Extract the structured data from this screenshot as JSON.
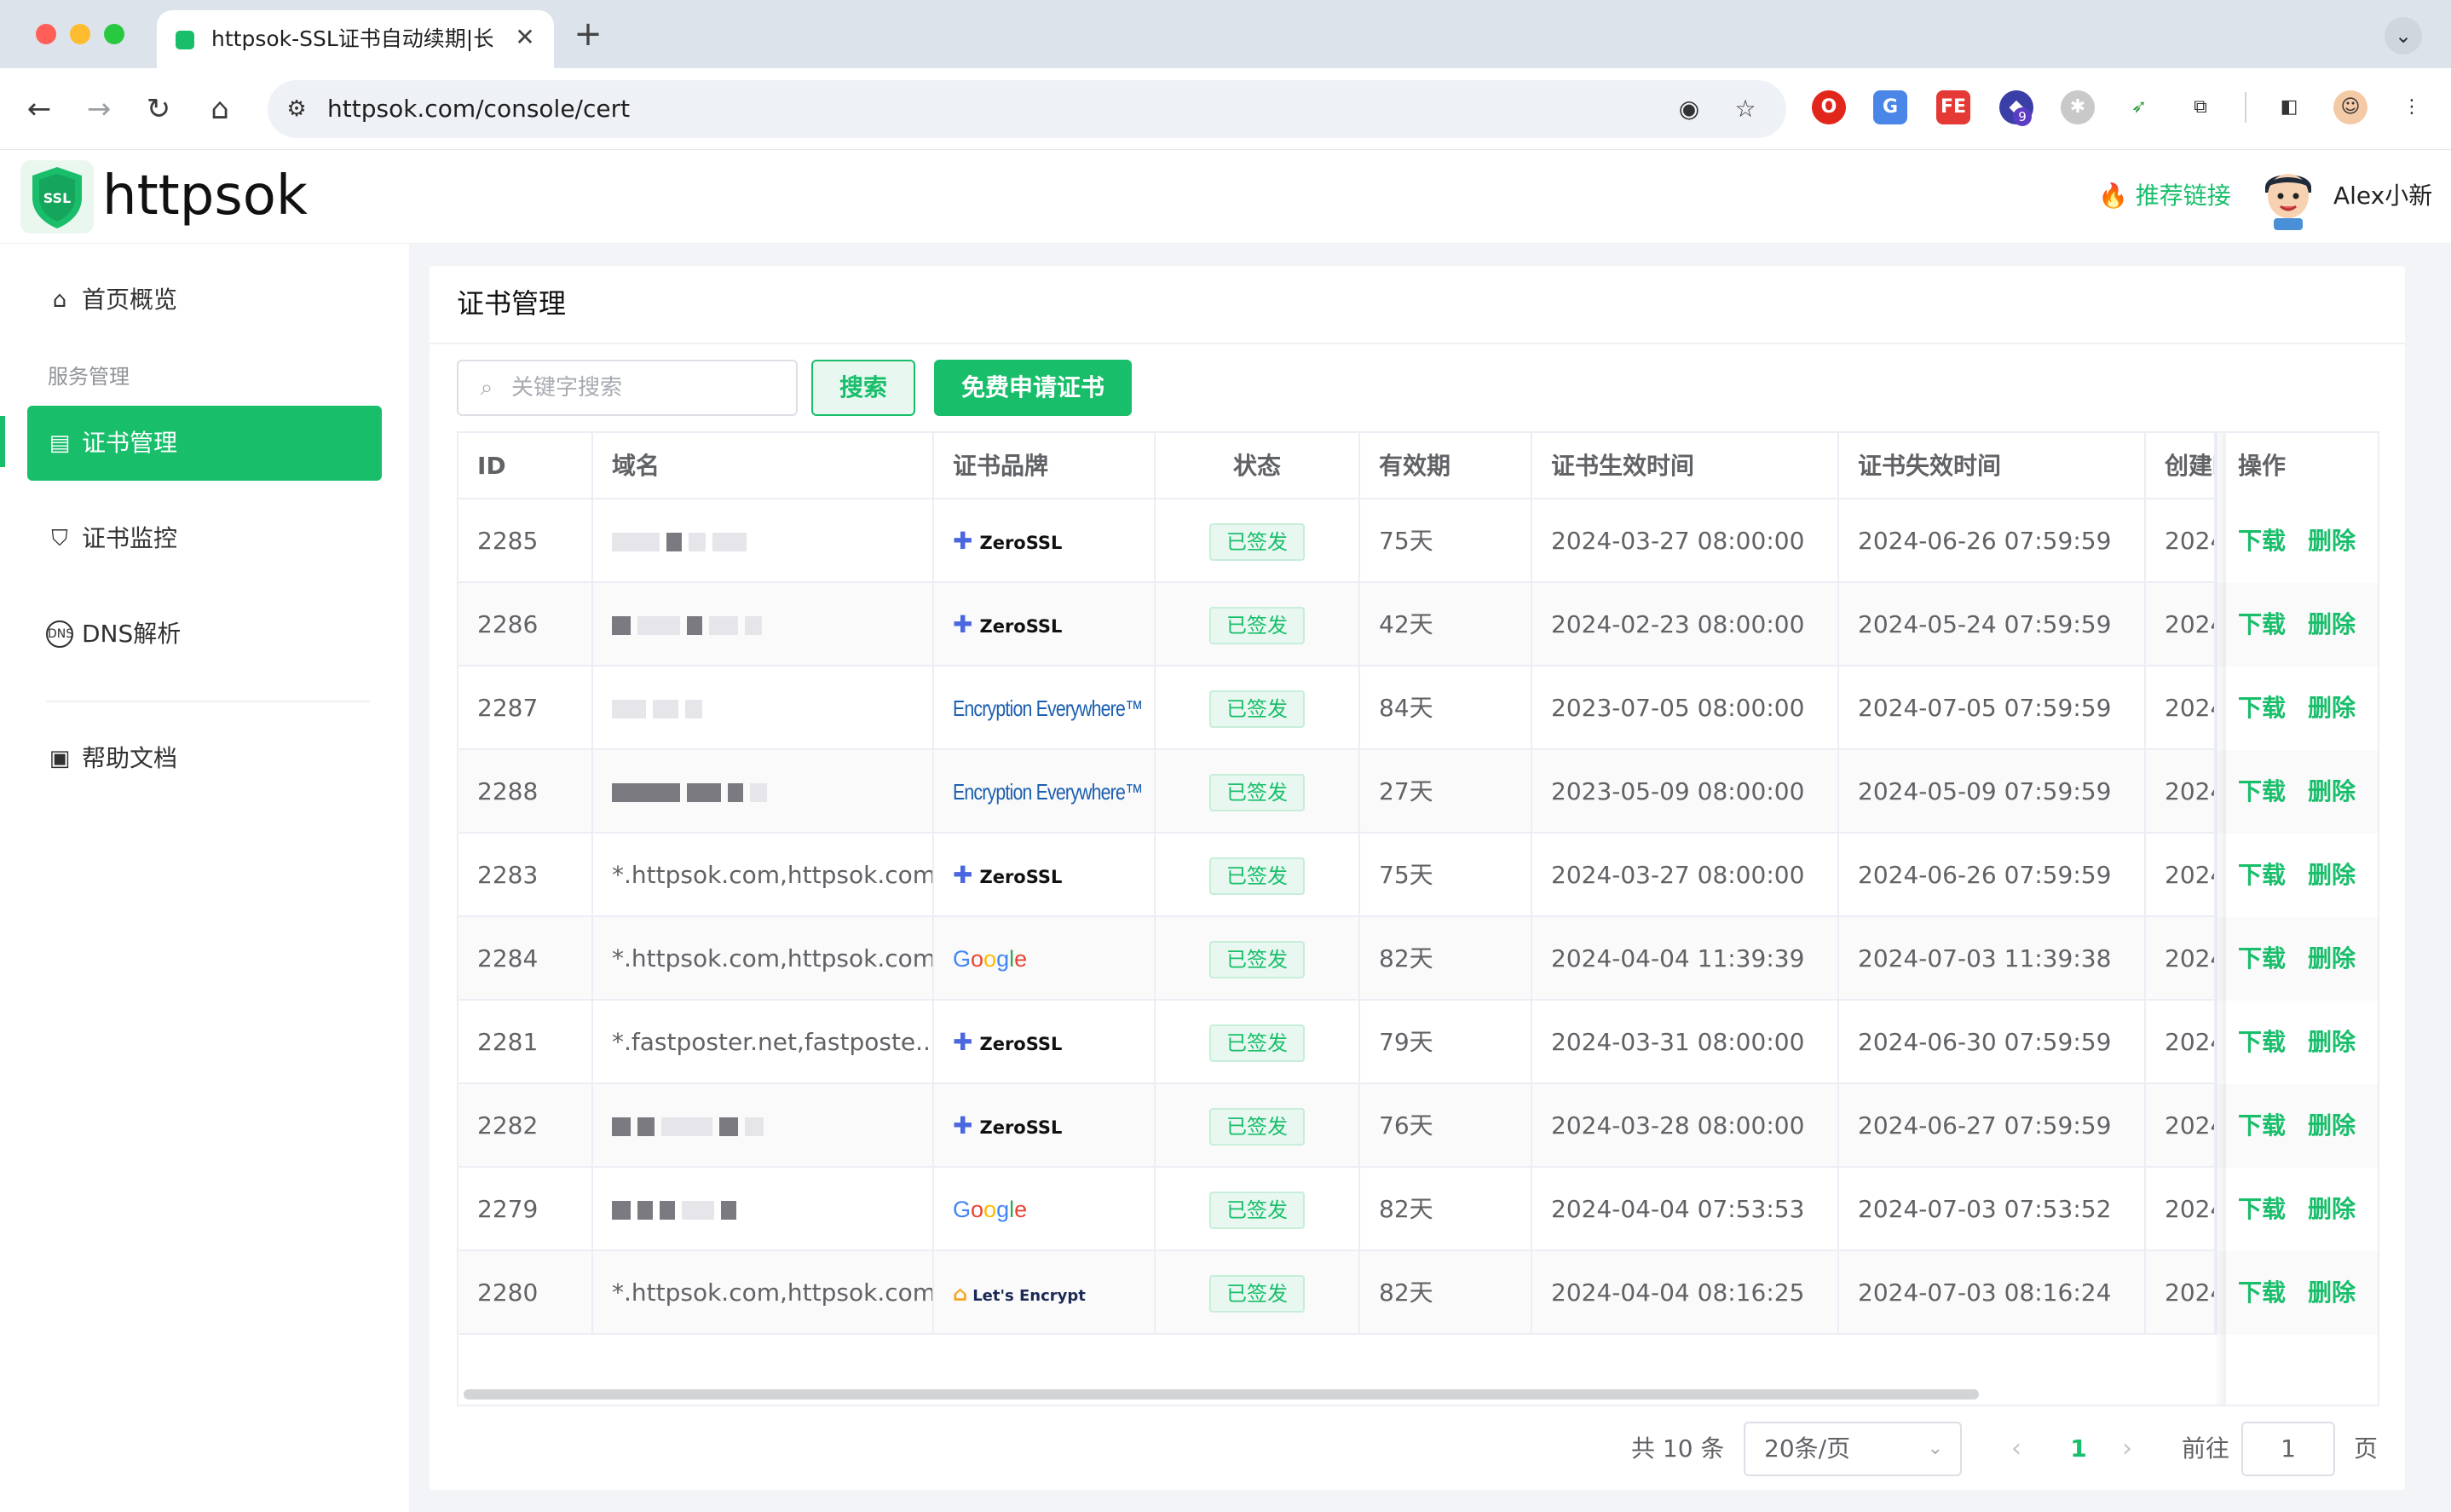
{
  "browser": {
    "tab_title": "httpsok-SSL证书自动续期|长沙",
    "tab_close": "✕",
    "new_tab": "+",
    "url": "httpsok.com/console/cert",
    "extension_badge": "9"
  },
  "header": {
    "logo_text": "httpsok",
    "logo_badge": "SSL",
    "recommend": "推荐链接",
    "recommend_icon": "🔥",
    "username": "Alex小新"
  },
  "sidebar": {
    "items": [
      {
        "label": "首页概览",
        "icon": "home-icon"
      },
      {
        "label": "证书管理",
        "icon": "certificate-icon"
      },
      {
        "label": "证书监控",
        "icon": "shield-icon"
      },
      {
        "label": "DNS解析",
        "icon": "dns-icon"
      },
      {
        "label": "帮助文档",
        "icon": "book-icon"
      }
    ],
    "group_label": "服务管理"
  },
  "page": {
    "title": "证书管理",
    "search_placeholder": "关键字搜索",
    "search_button": "搜索",
    "apply_button": "免费申请证书"
  },
  "table": {
    "columns": [
      "ID",
      "域名",
      "证书品牌",
      "状态",
      "有效期",
      "证书生效时间",
      "证书失效时间",
      "创建时间",
      "操作"
    ],
    "rows": [
      {
        "id": "2285",
        "domain": "",
        "brand": "ZeroSSL",
        "status": "已签发",
        "validity": "75天",
        "start": "2024-03-27 08:00:00",
        "end": "2024-06-26 07:59:59",
        "created": "2024"
      },
      {
        "id": "2286",
        "domain": "",
        "brand": "ZeroSSL",
        "status": "已签发",
        "validity": "42天",
        "start": "2024-02-23 08:00:00",
        "end": "2024-05-24 07:59:59",
        "created": "2024"
      },
      {
        "id": "2287",
        "domain": "",
        "brand": "Encryption Everywhere™",
        "status": "已签发",
        "validity": "84天",
        "start": "2023-07-05 08:00:00",
        "end": "2024-07-05 07:59:59",
        "created": "2024"
      },
      {
        "id": "2288",
        "domain": "",
        "brand": "Encryption Everywhere™",
        "status": "已签发",
        "validity": "27天",
        "start": "2023-05-09 08:00:00",
        "end": "2024-05-09 07:59:59",
        "created": "2024"
      },
      {
        "id": "2283",
        "domain": "*.httpsok.com,httpsok.com",
        "brand": "ZeroSSL",
        "status": "已签发",
        "validity": "75天",
        "start": "2024-03-27 08:00:00",
        "end": "2024-06-26 07:59:59",
        "created": "2024"
      },
      {
        "id": "2284",
        "domain": "*.httpsok.com,httpsok.com",
        "brand": "Google",
        "status": "已签发",
        "validity": "82天",
        "start": "2024-04-04 11:39:39",
        "end": "2024-07-03 11:39:38",
        "created": "2024"
      },
      {
        "id": "2281",
        "domain": "*.fastposter.net,fastposte...",
        "brand": "ZeroSSL",
        "status": "已签发",
        "validity": "79天",
        "start": "2024-03-31 08:00:00",
        "end": "2024-06-30 07:59:59",
        "created": "2024"
      },
      {
        "id": "2282",
        "domain": "",
        "brand": "ZeroSSL",
        "status": "已签发",
        "validity": "76天",
        "start": "2024-03-28 08:00:00",
        "end": "2024-06-27 07:59:59",
        "created": "2024"
      },
      {
        "id": "2279",
        "domain": "",
        "brand": "Google",
        "status": "已签发",
        "validity": "82天",
        "start": "2024-04-04 07:53:53",
        "end": "2024-07-03 07:53:52",
        "created": "2024"
      },
      {
        "id": "2280",
        "domain": "*.httpsok.com,httpsok.com",
        "brand": "Let's Encrypt",
        "status": "已签发",
        "validity": "82天",
        "start": "2024-04-04 08:16:25",
        "end": "2024-07-03 08:16:24",
        "created": "2024"
      }
    ],
    "actions": {
      "download": "下载",
      "delete": "删除"
    }
  },
  "pagination": {
    "total": "共 10 条",
    "page_size": "20条/页",
    "current_page": "1",
    "goto_label": "前往",
    "goto_value": "1",
    "page_suffix": "页"
  },
  "colors": {
    "accent": "#19be6b",
    "zerossl": "#4b67e0",
    "encryption_everywhere": "#1c5fb0"
  }
}
